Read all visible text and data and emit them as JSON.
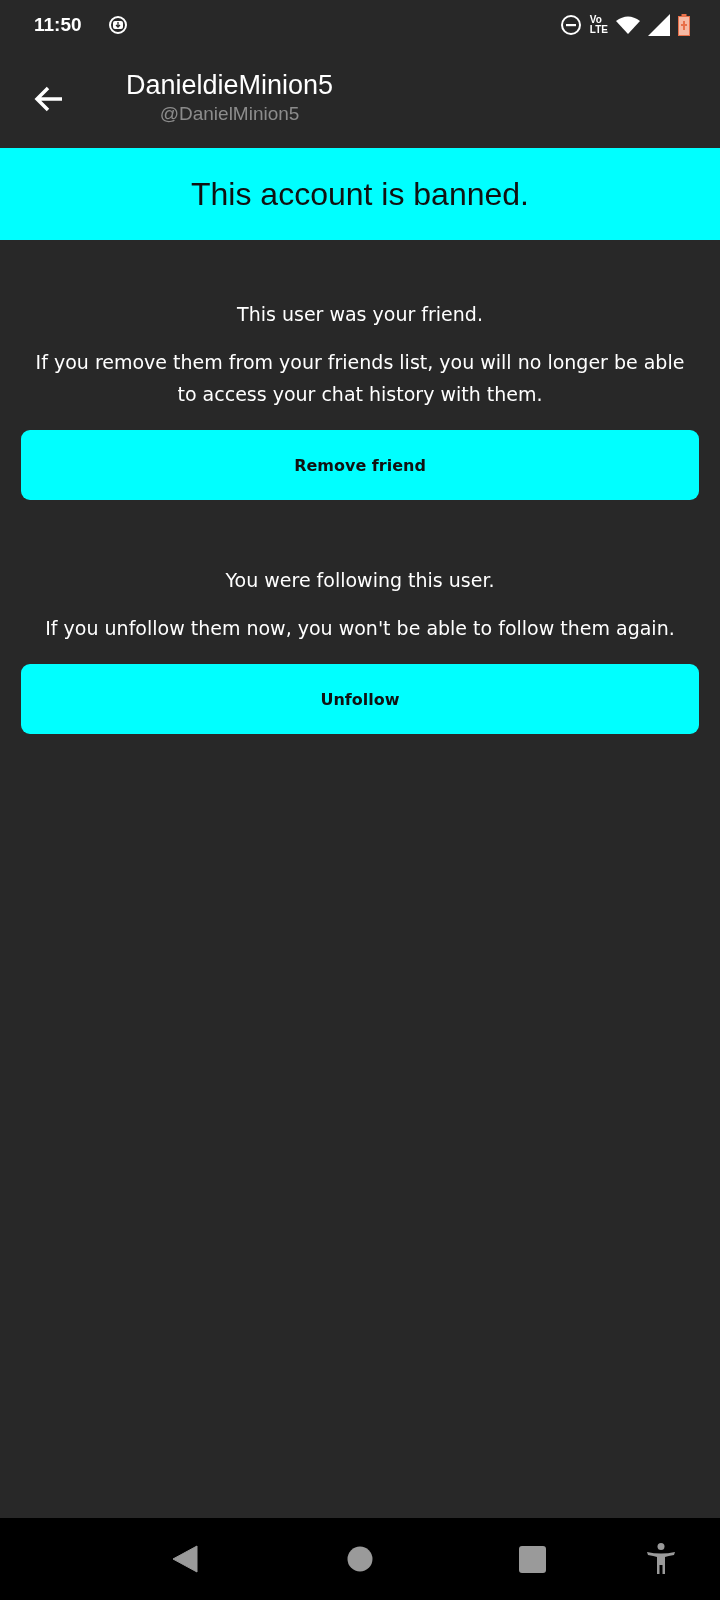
{
  "status_bar": {
    "time": "11:50",
    "network_top": "Vo",
    "network_bottom": "LTE"
  },
  "header": {
    "title": "DanieldieMinion5",
    "subtitle": "@DanielMinion5"
  },
  "banner": {
    "text": "This account is banned."
  },
  "sections": [
    {
      "heading": "This user was your friend.",
      "body": "If you remove them from your friends list, you will no longer be able to access your chat history with them.",
      "button": "Remove friend"
    },
    {
      "heading": "You were following this user.",
      "body": "If you unfollow them now, you won't be able to follow them again.",
      "button": "Unfollow"
    }
  ]
}
